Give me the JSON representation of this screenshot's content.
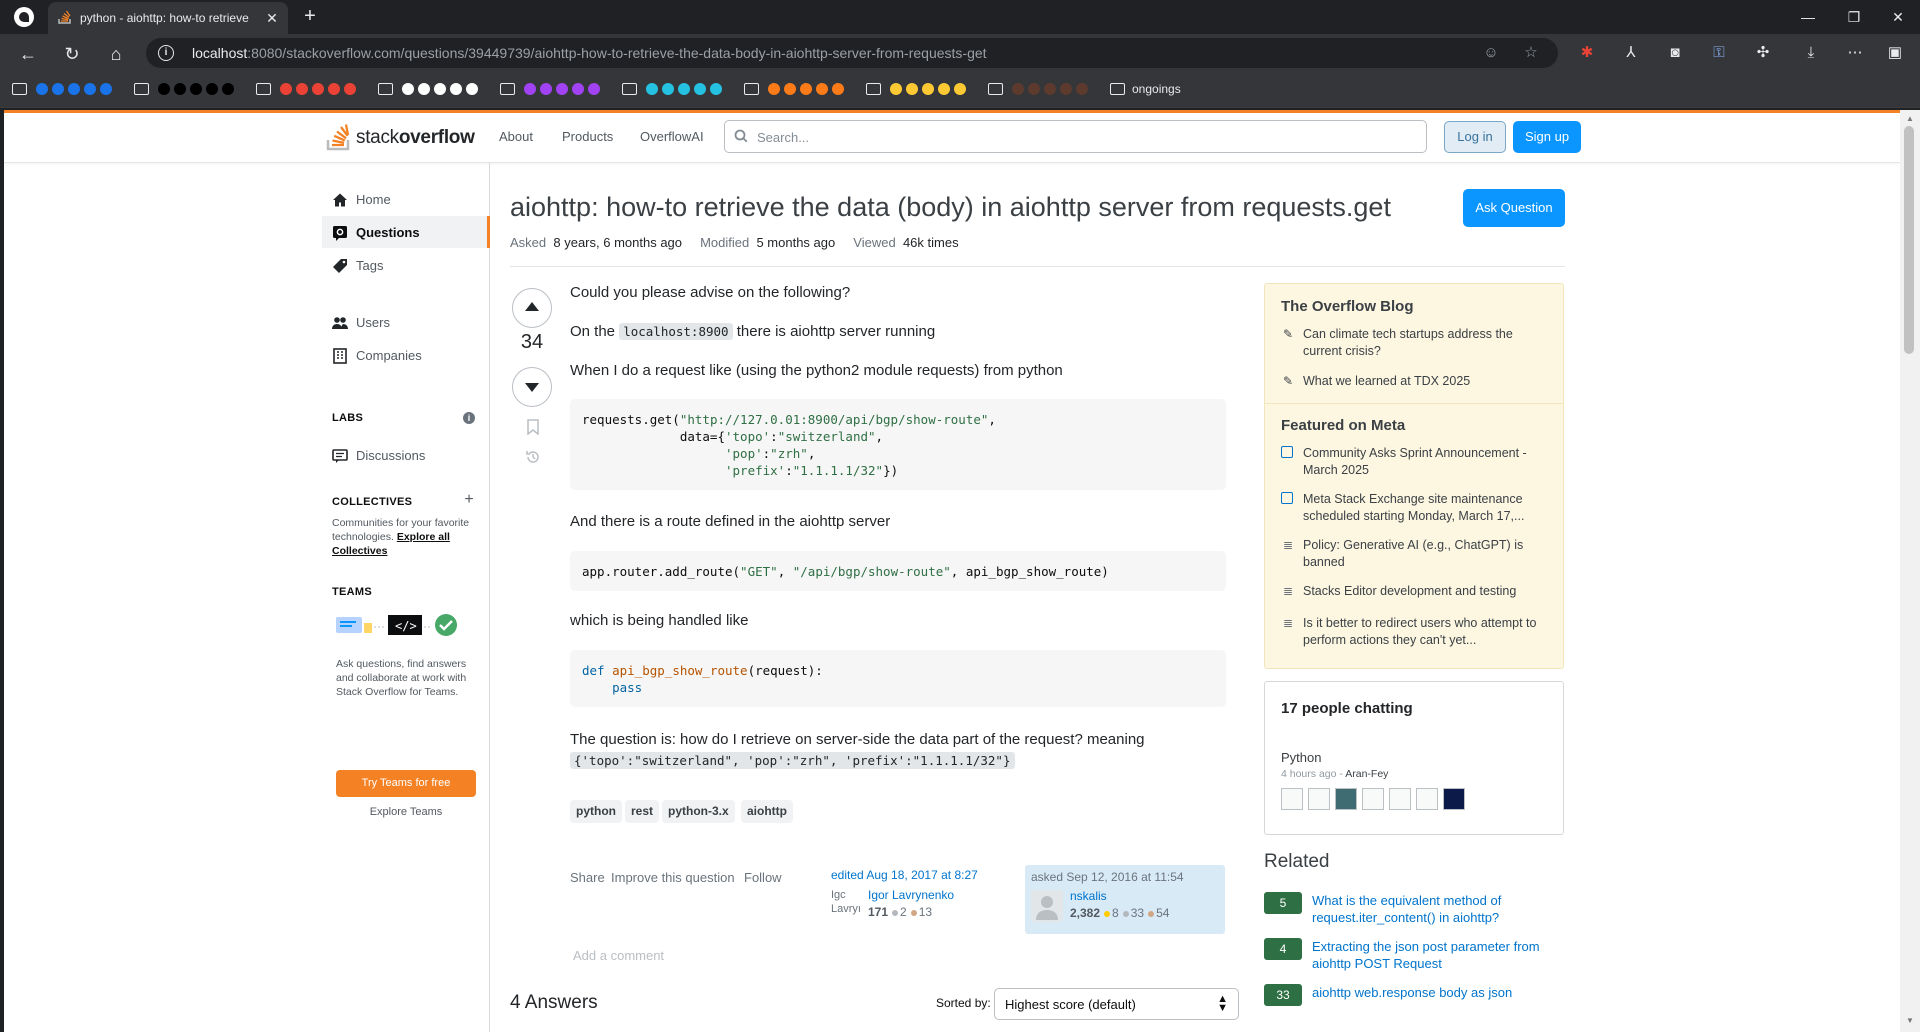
{
  "browser": {
    "tab_title": "python - aiohttp: how-to retrieve",
    "url_host": "localhost",
    "url_rest": ":8080/stackoverflow.com/questions/39449739/aiohttp-how-to-retrieve-the-data-body-in-aiohttp-server-from-requests-get",
    "bookmarks": {
      "last_folder": "ongoings",
      "dot_groups": [
        [
          "#1a73e8",
          "#1a73e8",
          "#1a73e8",
          "#1a73e8",
          "#1a73e8"
        ],
        [
          "#000000",
          "#000000",
          "#000000",
          "#000000",
          "#000000"
        ],
        [
          "#ea4335",
          "#ea4335",
          "#ea4335",
          "#ea4335",
          "#ea4335"
        ],
        [
          "#ffffff",
          "#ffffff",
          "#ffffff",
          "#ffffff",
          "#ffffff"
        ],
        [
          "#a142f4",
          "#a142f4",
          "#a142f4",
          "#a142f4",
          "#a142f4"
        ],
        [
          "#24c1e0",
          "#24c1e0",
          "#24c1e0",
          "#24c1e0",
          "#24c1e0"
        ],
        [
          "#fa7b17",
          "#fa7b17",
          "#fa7b17",
          "#fa7b17",
          "#fa7b17"
        ],
        [
          "#fcc934",
          "#fcc934",
          "#fcc934",
          "#fcc934",
          "#fcc934"
        ],
        [
          "#5c3a2e",
          "#5c3a2e",
          "#5c3a2e",
          "#5c3a2e",
          "#5c3a2e"
        ]
      ]
    }
  },
  "header": {
    "logo_plain": "stack",
    "logo_bold": "overflow",
    "nav": [
      "About",
      "Products",
      "OverflowAI"
    ],
    "search_placeholder": "Search...",
    "login": "Log in",
    "signup": "Sign up"
  },
  "leftnav": {
    "home": "Home",
    "questions": "Questions",
    "tags": "Tags",
    "users": "Users",
    "companies": "Companies",
    "labs_heading": "LABS",
    "discussions": "Discussions",
    "collectives_heading": "COLLECTIVES",
    "collectives_text": "Communities for your favorite technologies.",
    "collectives_link": "Explore all Collectives",
    "teams_heading": "TEAMS",
    "teams_text": "Ask questions, find answers and collaborate at work with Stack Overflow for Teams.",
    "teams_button": "Try Teams for free",
    "explore_teams": "Explore Teams"
  },
  "question": {
    "title": "aiohttp: how-to retrieve the data (body) in aiohttp server from requests.get",
    "ask_button": "Ask Question",
    "asked_label": "Asked",
    "asked_value": "8 years, 6 months ago",
    "modified_label": "Modified",
    "modified_value": "5 months ago",
    "viewed_label": "Viewed",
    "viewed_value": "46k times",
    "score": "34",
    "p1": "Could you please advise on the following?",
    "p2_before": "On the",
    "p2_code": "localhost:8900",
    "p2_after": "there is aiohttp server running",
    "p3": "When I do a request like (using the python2 module requests) from python",
    "code1": {
      "l1a": "requests.get(",
      "l1b": "\"http://127.0.01:8900/api/bgp/show-route\"",
      "l1c": ",",
      "l2a": "             data={",
      "l2b": "'topo'",
      "l2c": ":",
      "l2d": "\"switzerland\"",
      "l2e": ",",
      "l3a": "                   ",
      "l3b": "'pop'",
      "l3c": ":",
      "l3d": "\"zrh\"",
      "l3e": ",",
      "l4a": "                   ",
      "l4b": "'prefix'",
      "l4c": ":",
      "l4d": "\"1.1.1.1/32\"",
      "l4e": "})"
    },
    "p4": "And there is a route defined in the aiohttp server",
    "code2": {
      "a": "app.router.add_route(",
      "b": "\"GET\"",
      "c": ", ",
      "d": "\"/api/bgp/show-route\"",
      "e": ", api_bgp_show_route)"
    },
    "p5": "which is being handled like",
    "code3": {
      "kw": "def",
      "fn": "api_bgp_show_route",
      "rest": "(request):",
      "pass": "pass"
    },
    "p6": "The question is: how do I retrieve on server-side the data part of the request? meaning",
    "p6_code": "{'topo':\"switzerland\", 'pop':\"zrh\", 'prefix':\"1.1.1.1/32\"}",
    "tags": [
      "python",
      "rest",
      "python-3.x",
      "aiohttp"
    ],
    "menu": [
      "Share",
      "Improve this question",
      "Follow"
    ],
    "edited": "edited Aug 18, 2017 at 8:27",
    "editor_alt": "Igc Lavryı",
    "editor_name": "Igor Lavrynenko",
    "editor_rep": "171",
    "editor_silver": "2",
    "editor_bronze": "13",
    "asked_card": "asked Sep 12, 2016 at 11:54",
    "asker_name": "nskalis",
    "asker_rep": "2,382",
    "asker_gold": "8",
    "asker_silver": "33",
    "asker_bronze": "54",
    "add_comment": "Add a comment"
  },
  "answers": {
    "heading": "4 Answers",
    "sorted_label": "Sorted by:",
    "sort_value": "Highest score (default)"
  },
  "sidebar": {
    "blog_heading": "The Overflow Blog",
    "blog_items": [
      "Can climate tech startups address the current crisis?",
      "What we learned at TDX 2025"
    ],
    "meta_heading": "Featured on Meta",
    "meta_items": [
      "Community Asks Sprint Announcement - March 2025",
      "Meta Stack Exchange site maintenance scheduled starting Monday, March 17,...",
      "Policy: Generative AI (e.g., ChatGPT) is banned",
      "Stacks Editor development and testing",
      "Is it better to redirect users who attempt to perform actions they can't yet..."
    ],
    "chat_heading": "17 people chatting",
    "chat_room": "Python",
    "chat_time": "4 hours ago",
    "chat_user": "Aran-Fey",
    "related_heading": "Related",
    "related": [
      {
        "score": "5",
        "title": "What is the equivalent method of request.iter_content() in aiohttp?"
      },
      {
        "score": "4",
        "title": "Extracting the json post parameter from aiohttp POST Request"
      },
      {
        "score": "33",
        "title": "aiohttp web.response body as json"
      }
    ]
  }
}
